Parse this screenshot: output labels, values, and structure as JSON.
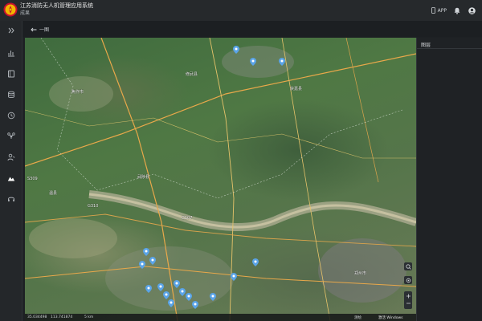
{
  "header": {
    "title": "江苏消防无人机管理应用系统",
    "subtitle": "成果",
    "app_label": "APP",
    "bell_count": "0"
  },
  "subheader": {
    "back_label": "一图"
  },
  "right_panel": {
    "title": "图层"
  },
  "map": {
    "labels": [
      {
        "text": "焦作市"
      },
      {
        "text": "修武县"
      },
      {
        "text": "获嘉县"
      },
      {
        "text": "武陟县"
      },
      {
        "text": "温县"
      },
      {
        "text": "G107"
      },
      {
        "text": "S309"
      },
      {
        "text": "G310"
      },
      {
        "text": "郑州市"
      }
    ],
    "scale": "5 km"
  },
  "status": {
    "lat": "35.034498",
    "lon": "113.741874",
    "scale": "5 km",
    "watermark": "激活 Windows",
    "credit": "测绘"
  },
  "colors": {
    "header_bg": "#26292c",
    "sidebar_bg": "#24272a",
    "marker": "#5aa4e8"
  }
}
